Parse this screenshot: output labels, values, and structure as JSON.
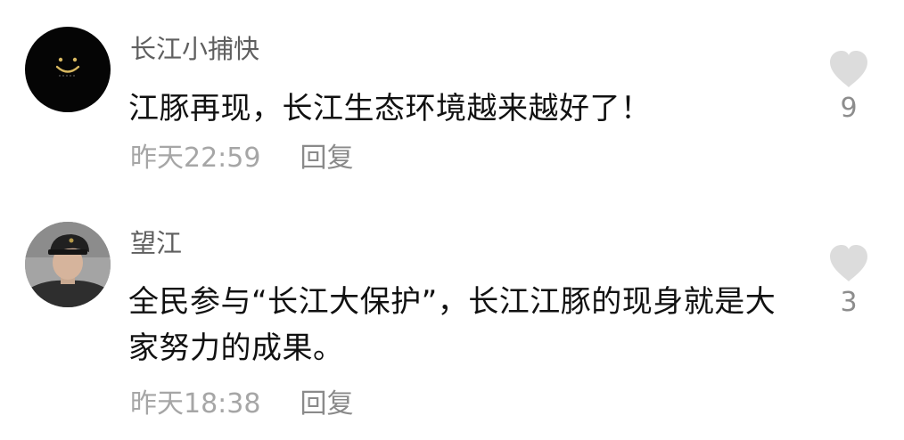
{
  "colors": {
    "username": "#5f5f5f",
    "comment_text": "#111111",
    "meta_text": "#a6a6a6",
    "heart": "#dcdcdc",
    "avatar1_bg": "#050505",
    "smiley": "#d8b860"
  },
  "comments": [
    {
      "username": "长江小捕快",
      "avatar_icon": "smiley-face-icon",
      "text": "江豚再现，长江生态环境越来越好了！",
      "time": "昨天22:59",
      "reply_label": "回复",
      "likes": "9"
    },
    {
      "username": "望江",
      "avatar_icon": "person-photo-avatar",
      "text": "全民参与“长江大保护”，长江江豚的现身就是大家努力的成果。",
      "time": "昨天18:38",
      "reply_label": "回复",
      "likes": "3"
    }
  ]
}
